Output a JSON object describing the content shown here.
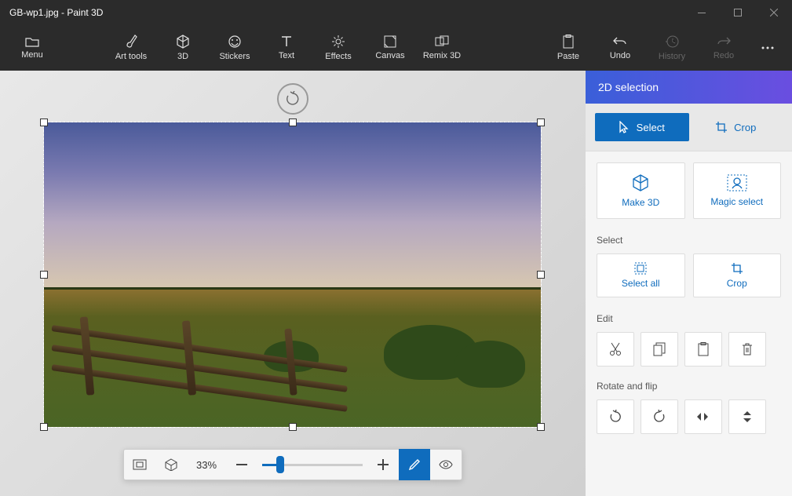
{
  "title": "GB-wp1.jpg - Paint 3D",
  "ribbon": {
    "menu": "Menu",
    "art_tools": "Art tools",
    "three_d": "3D",
    "stickers": "Stickers",
    "text": "Text",
    "effects": "Effects",
    "canvas": "Canvas",
    "remix_3d": "Remix 3D",
    "paste": "Paste",
    "undo": "Undo",
    "history": "History",
    "redo": "Redo"
  },
  "zoom": {
    "percent": "33%"
  },
  "panel": {
    "title": "2D selection",
    "mode_select": "Select",
    "mode_crop": "Crop",
    "make_3d": "Make 3D",
    "magic_select": "Magic select",
    "section_select": "Select",
    "select_all": "Select all",
    "crop": "Crop",
    "section_edit": "Edit",
    "section_rotate": "Rotate and flip"
  }
}
